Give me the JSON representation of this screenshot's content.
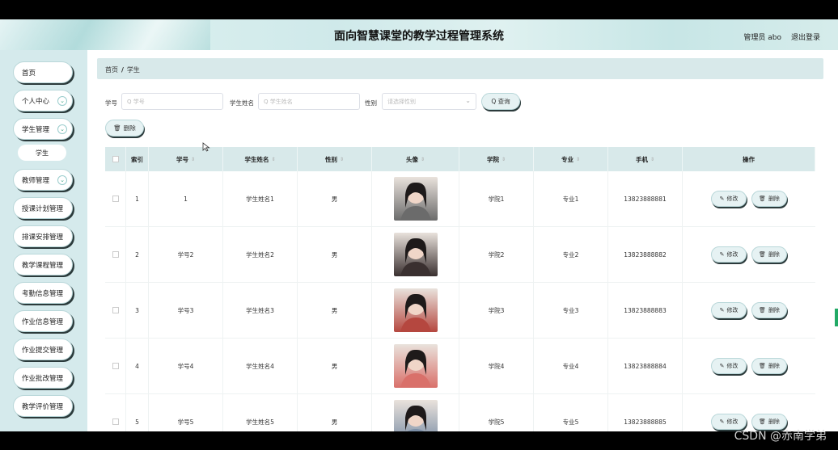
{
  "header": {
    "title": "面向智慧课堂的教学过程管理系统",
    "user": "管理员 abo",
    "logout": "退出登录"
  },
  "sidebar": {
    "items": [
      {
        "label": "首页",
        "has_chevron": false
      },
      {
        "label": "个人中心",
        "has_chevron": true
      },
      {
        "label": "学生管理",
        "has_chevron": true
      },
      {
        "label": "教师管理",
        "has_chevron": true
      },
      {
        "label": "授课计划管理",
        "has_chevron": false
      },
      {
        "label": "排课安排管理",
        "has_chevron": false
      },
      {
        "label": "教学课程管理",
        "has_chevron": false
      },
      {
        "label": "考勤信息管理",
        "has_chevron": false
      },
      {
        "label": "作业信息管理",
        "has_chevron": false
      },
      {
        "label": "作业提交管理",
        "has_chevron": false
      },
      {
        "label": "作业批改管理",
        "has_chevron": false
      },
      {
        "label": "教学评价管理",
        "has_chevron": false
      }
    ],
    "sub_item": "学生"
  },
  "breadcrumb": {
    "home": "首页",
    "sep": "/",
    "current": "学生"
  },
  "search": {
    "student_no_label": "学号",
    "student_no_placeholder": "Q 学号",
    "student_name_label": "学生姓名",
    "student_name_placeholder": "Q 学生姓名",
    "gender_label": "性别",
    "gender_placeholder": "请选择性别",
    "query_button": "Q 查询",
    "delete_button": "删除"
  },
  "table": {
    "headers": [
      "索引",
      "学号",
      "学生姓名",
      "性别",
      "头像",
      "学院",
      "专业",
      "手机",
      "操作"
    ],
    "rows": [
      {
        "index": "1",
        "student_no": "1",
        "name": "学生姓名1",
        "gender": "男",
        "college": "学院1",
        "major": "专业1",
        "phone": "13823888881",
        "avatar_color": "#6b6b6b"
      },
      {
        "index": "2",
        "student_no": "学号2",
        "name": "学生姓名2",
        "gender": "男",
        "college": "学院2",
        "major": "专业2",
        "phone": "13823888882",
        "avatar_color": "#3a3030"
      },
      {
        "index": "3",
        "student_no": "学号3",
        "name": "学生姓名3",
        "gender": "男",
        "college": "学院3",
        "major": "专业3",
        "phone": "13823888883",
        "avatar_color": "#b5473f"
      },
      {
        "index": "4",
        "student_no": "学号4",
        "name": "学生姓名4",
        "gender": "男",
        "college": "学院4",
        "major": "专业4",
        "phone": "13823888884",
        "avatar_color": "#d9706a"
      },
      {
        "index": "5",
        "student_no": "学号5",
        "name": "学生姓名5",
        "gender": "男",
        "college": "学院5",
        "major": "专业5",
        "phone": "13823888885",
        "avatar_color": "#7b8ea6"
      }
    ],
    "edit_label": "修改",
    "delete_label": "删除"
  },
  "watermark": "CSDN @赤南学弟"
}
